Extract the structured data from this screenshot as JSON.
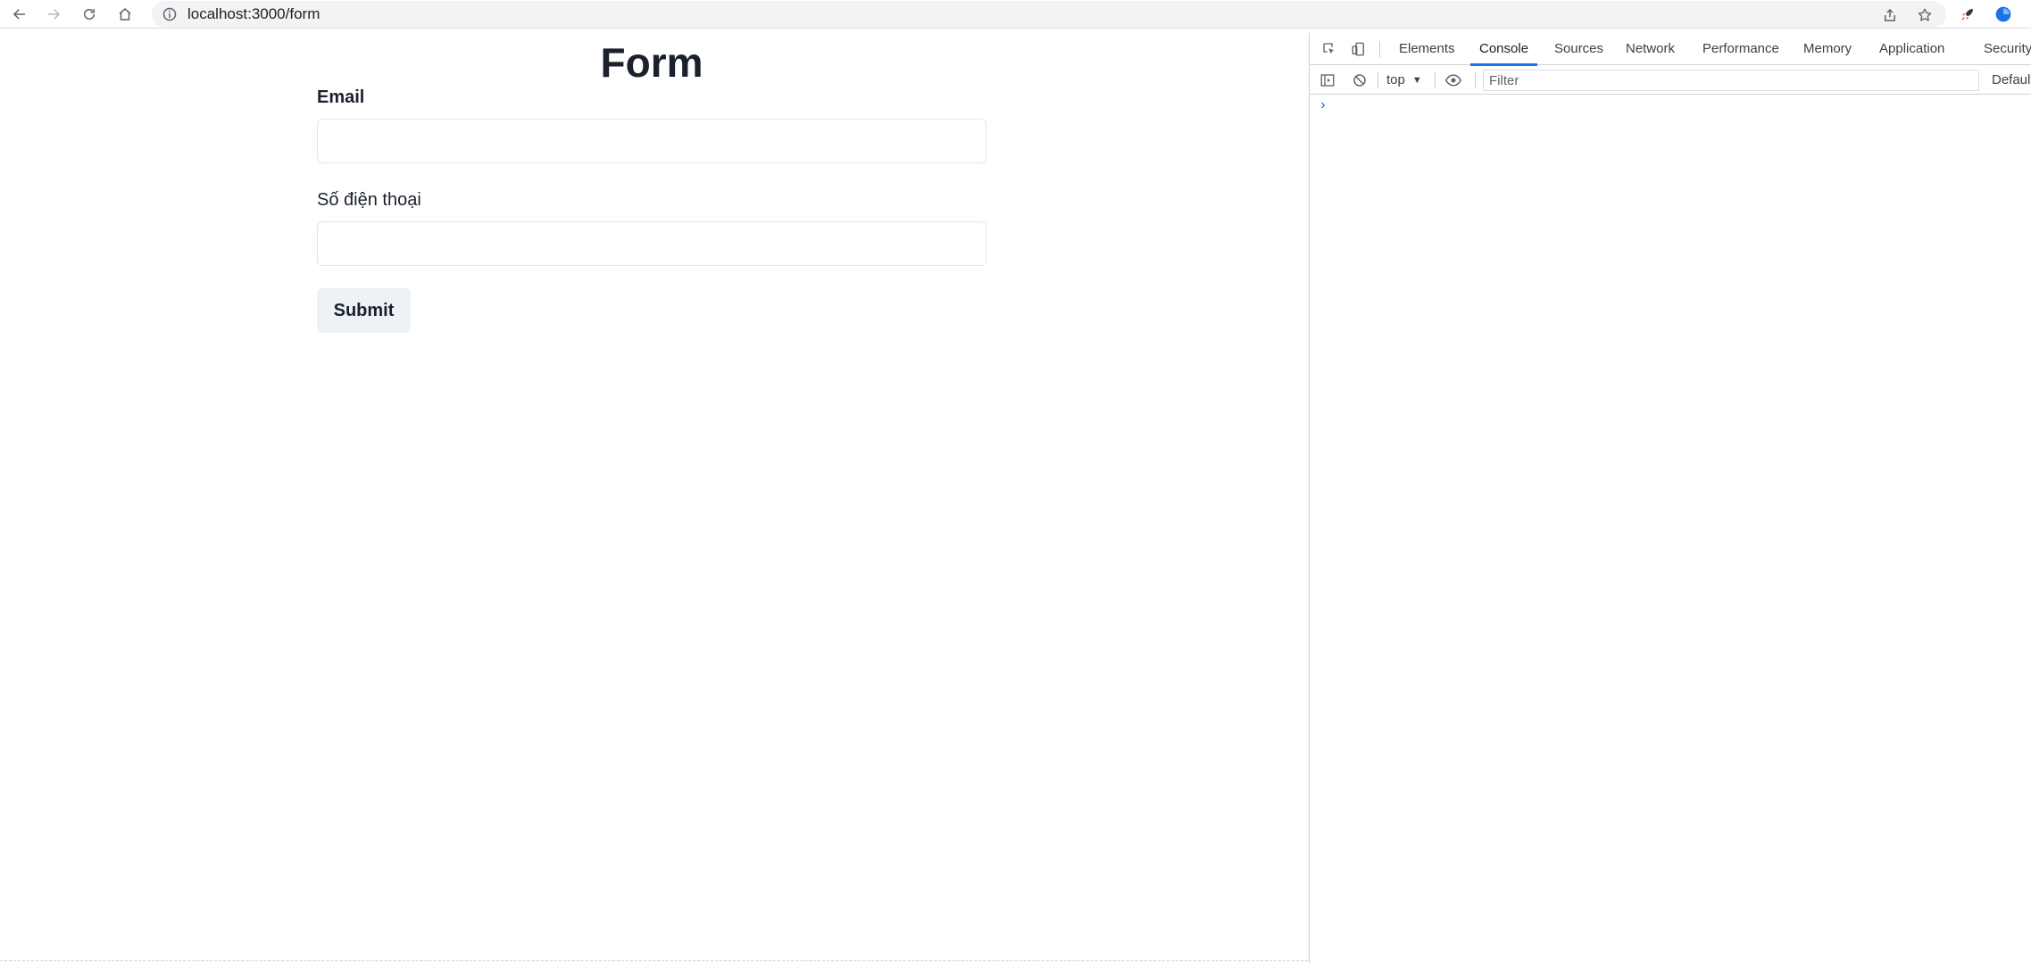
{
  "browser": {
    "url": "localhost:3000/form"
  },
  "page": {
    "title": "Form",
    "fields": [
      {
        "label": "Email",
        "value": ""
      },
      {
        "label": "Số điện thoại",
        "value": ""
      }
    ],
    "submit_label": "Submit"
  },
  "devtools": {
    "tabs": [
      "Elements",
      "Console",
      "Sources",
      "Network",
      "Performance",
      "Memory",
      "Application",
      "Security"
    ],
    "active_tab": "Console",
    "context": "top",
    "filter_placeholder": "Filter",
    "levels_label": "Default",
    "prompt_glyph": "›"
  },
  "colors": {
    "accent": "#1a73e8",
    "heading": "#1a202c",
    "button_bg": "#edf2f7",
    "input_border": "#e2e8f0"
  }
}
